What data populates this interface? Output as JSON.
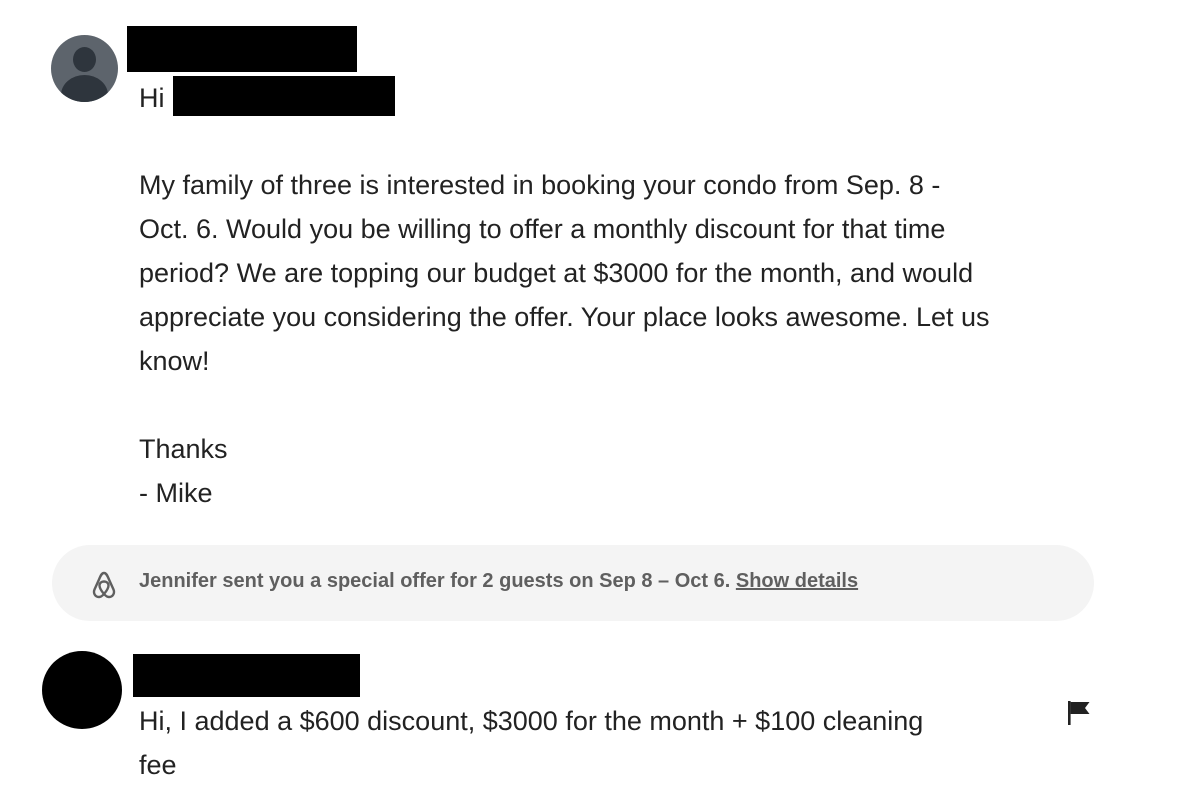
{
  "guest_message": {
    "greeting": "Hi",
    "lines": [
      "My family of three is interested in booking your condo from Sep. 8 -",
      "Oct. 6. Would you be willing to offer a monthly discount for that time",
      "period? We are topping our budget at $3000 for the month, and would",
      "appreciate you considering the offer. Your place looks awesome. Let us",
      "know!"
    ],
    "signoff": "Thanks",
    "signature": "- Mike"
  },
  "special_offer_notice": {
    "text": "Jennifer sent you a special offer for 2 guests on Sep 8 – Oct 6.",
    "link_label": "Show details",
    "icon": "airbnb-logo-icon"
  },
  "host_message": {
    "lines": [
      "Hi, I added a $600 discount, $3000 for the month + $100 cleaning",
      "fee"
    ],
    "report_icon": "flag-icon"
  },
  "colors": {
    "text": "#222222",
    "notice_background": "#f4f4f4",
    "notice_text": "#5f5f5f",
    "guest_avatar": "#5d646c",
    "redaction": "#000000"
  }
}
